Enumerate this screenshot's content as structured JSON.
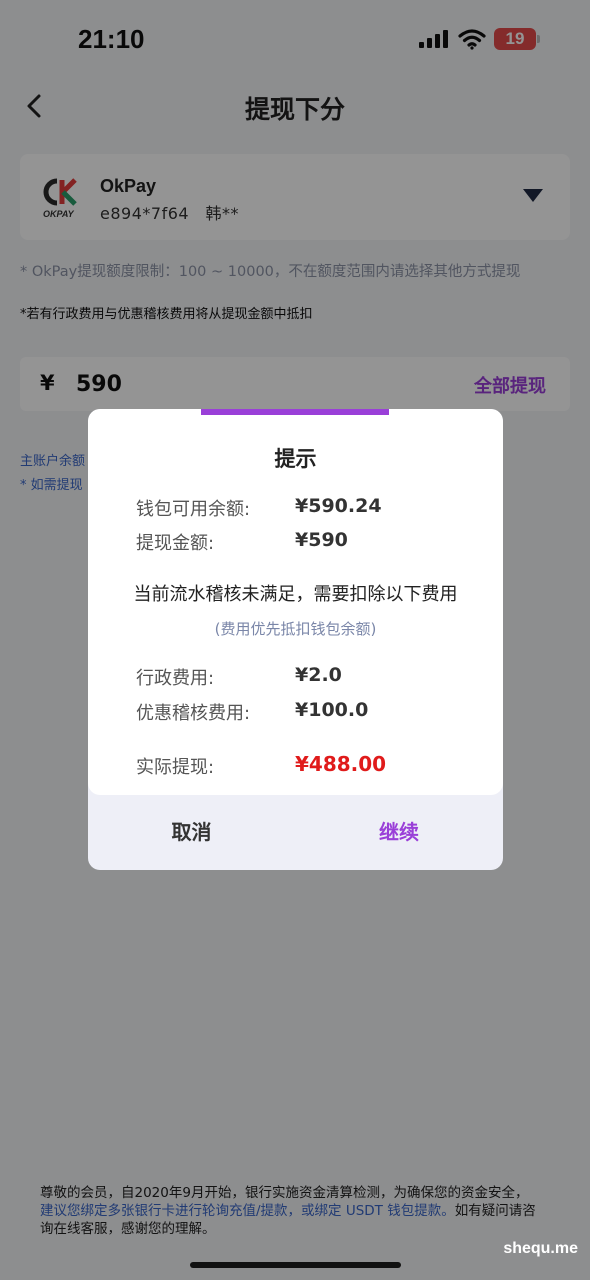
{
  "status_bar": {
    "time": "21:10",
    "battery": "19",
    "battery_color": "#e34a4a"
  },
  "nav": {
    "title": "提现下分",
    "back_icon": "chevron-left-icon"
  },
  "payment_method": {
    "logo_text": "OKPAY",
    "name": "OkPay",
    "account": "e894*7f64　韩**",
    "dropdown_icon": "triangle-down-icon"
  },
  "limit_note": "* OkPay提现额度限制：100 ~ 10000，不在额度范围内请选择其他方式提现",
  "fee_note": "*若有行政费用与优惠稽核费用将从提现金额中抵扣",
  "amount": {
    "currency": "¥",
    "value": "590",
    "withdraw_all_label": "全部提现"
  },
  "background_partial": {
    "balance_prefix": "主账户余额",
    "hint_prefix": "* 如需提现"
  },
  "dialog": {
    "title": "提示",
    "wallet_balance_label": "钱包可用余额:",
    "wallet_balance_value": "¥590.24",
    "withdraw_amount_label": "提现金额:",
    "withdraw_amount_value": "¥590",
    "notice": "当前流水稽核未满足，需要扣除以下费用",
    "sub_notice": "(费用优先抵扣钱包余额)",
    "admin_fee_label": "行政费用:",
    "admin_fee_value": "¥2.0",
    "promo_fee_label": "优惠稽核费用:",
    "promo_fee_value": "¥100.0",
    "actual_label": "实际提现:",
    "actual_value": "¥488.00",
    "cancel_label": "取消",
    "continue_label": "继续",
    "accent_color": "#9a3fd8",
    "actual_color": "#e01b1b"
  },
  "footer": {
    "line1": "尊敬的会员，自2020年9月开始，银行实施资金清算检测，为确保您的资金安全，",
    "line2": "建议您绑定多张银行卡进行轮询充值/提款，或绑定 USDT 钱包提款。",
    "line2_tail": "如有疑问请咨",
    "line3": "询在线客服，感谢您的理解。"
  },
  "watermark": "shequ.me"
}
